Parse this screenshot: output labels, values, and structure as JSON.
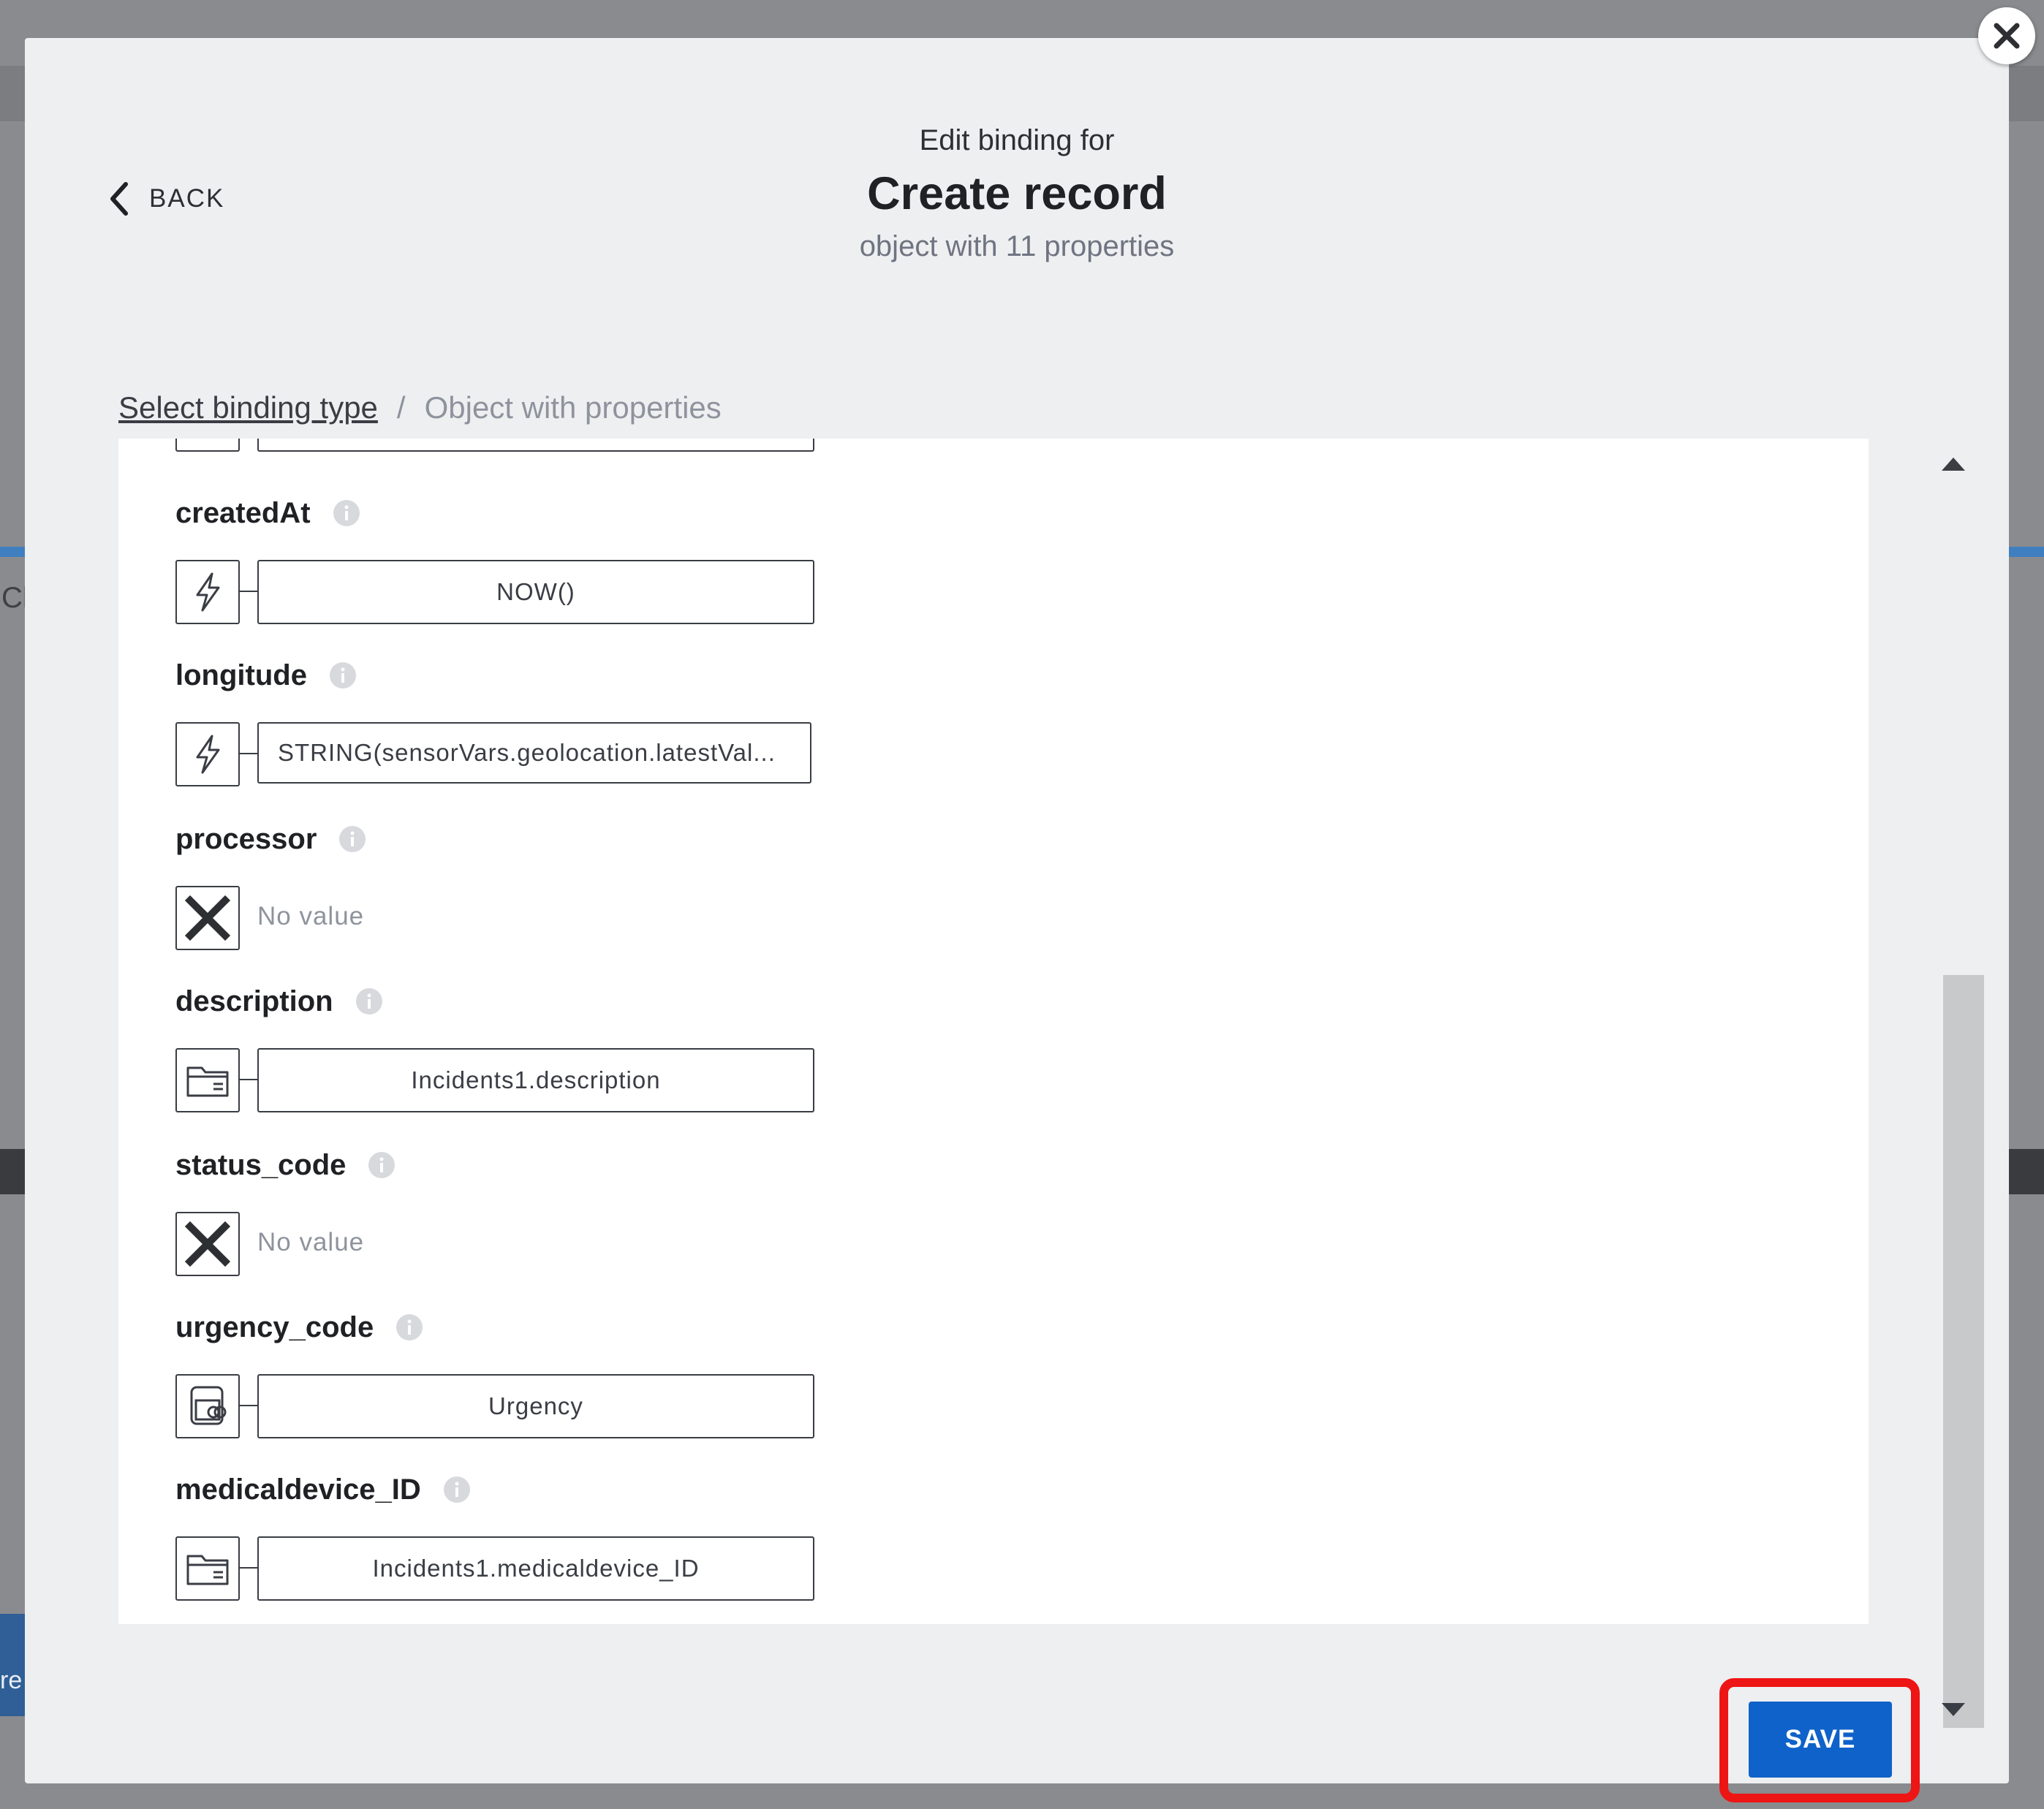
{
  "modal": {
    "header_subtitle": "Edit binding for",
    "title": "Create record",
    "note": "object with 11 properties",
    "back_label": "BACK"
  },
  "breadcrumb": {
    "link": "Select binding type",
    "separator": "/",
    "current": "Object with properties"
  },
  "background": {
    "fragment_1": "Cl",
    "fragment_2": "re"
  },
  "properties": [
    {
      "name": "createdAt",
      "type_icon": "lightning-icon",
      "value": "NOW()"
    },
    {
      "name": "longitude",
      "type_icon": "lightning-icon",
      "value": "STRING(sensorVars.geolocation.latestVal..."
    },
    {
      "name": "processor",
      "type_icon": "x-mark-icon",
      "value": "No value"
    },
    {
      "name": "description",
      "type_icon": "folder-icon",
      "value": "Incidents1.description"
    },
    {
      "name": "status_code",
      "type_icon": "x-mark-icon",
      "value": "No value"
    },
    {
      "name": "urgency_code",
      "type_icon": "linked-folder-icon",
      "value": "Urgency"
    },
    {
      "name": "medicaldevice_ID",
      "type_icon": "folder-icon",
      "value": "Incidents1.medicaldevice_ID"
    }
  ],
  "footer": {
    "save_label": "SAVE"
  },
  "colors": {
    "accent": "#0f62c9",
    "highlight": "#ee1515"
  }
}
